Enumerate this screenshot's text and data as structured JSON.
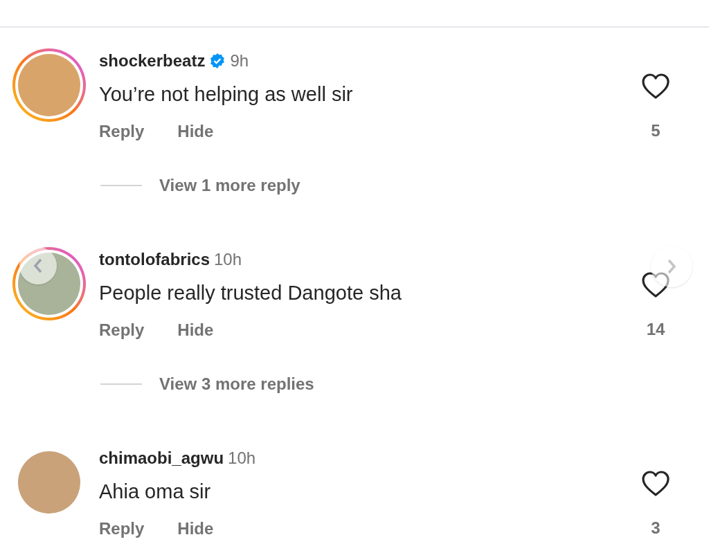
{
  "comments": [
    {
      "username": "shockerbeatz",
      "verified": true,
      "time": "9h",
      "text": "You’re not helping as well sir",
      "has_story": true,
      "actions": [
        "Reply",
        "Hide"
      ],
      "likes": "5",
      "view_replies": "View 1 more reply"
    },
    {
      "username": "tontolofabrics",
      "verified": false,
      "time": "10h",
      "text": "People really trusted Dangote sha",
      "has_story": true,
      "actions": [
        "Reply",
        "Hide"
      ],
      "likes": "14",
      "view_replies": "View 3 more replies"
    },
    {
      "username": "chimaobi_agwu",
      "verified": false,
      "time": "10h",
      "text": "Ahia oma sir",
      "has_story": false,
      "actions": [
        "Reply",
        "Hide"
      ],
      "likes": "3"
    }
  ]
}
